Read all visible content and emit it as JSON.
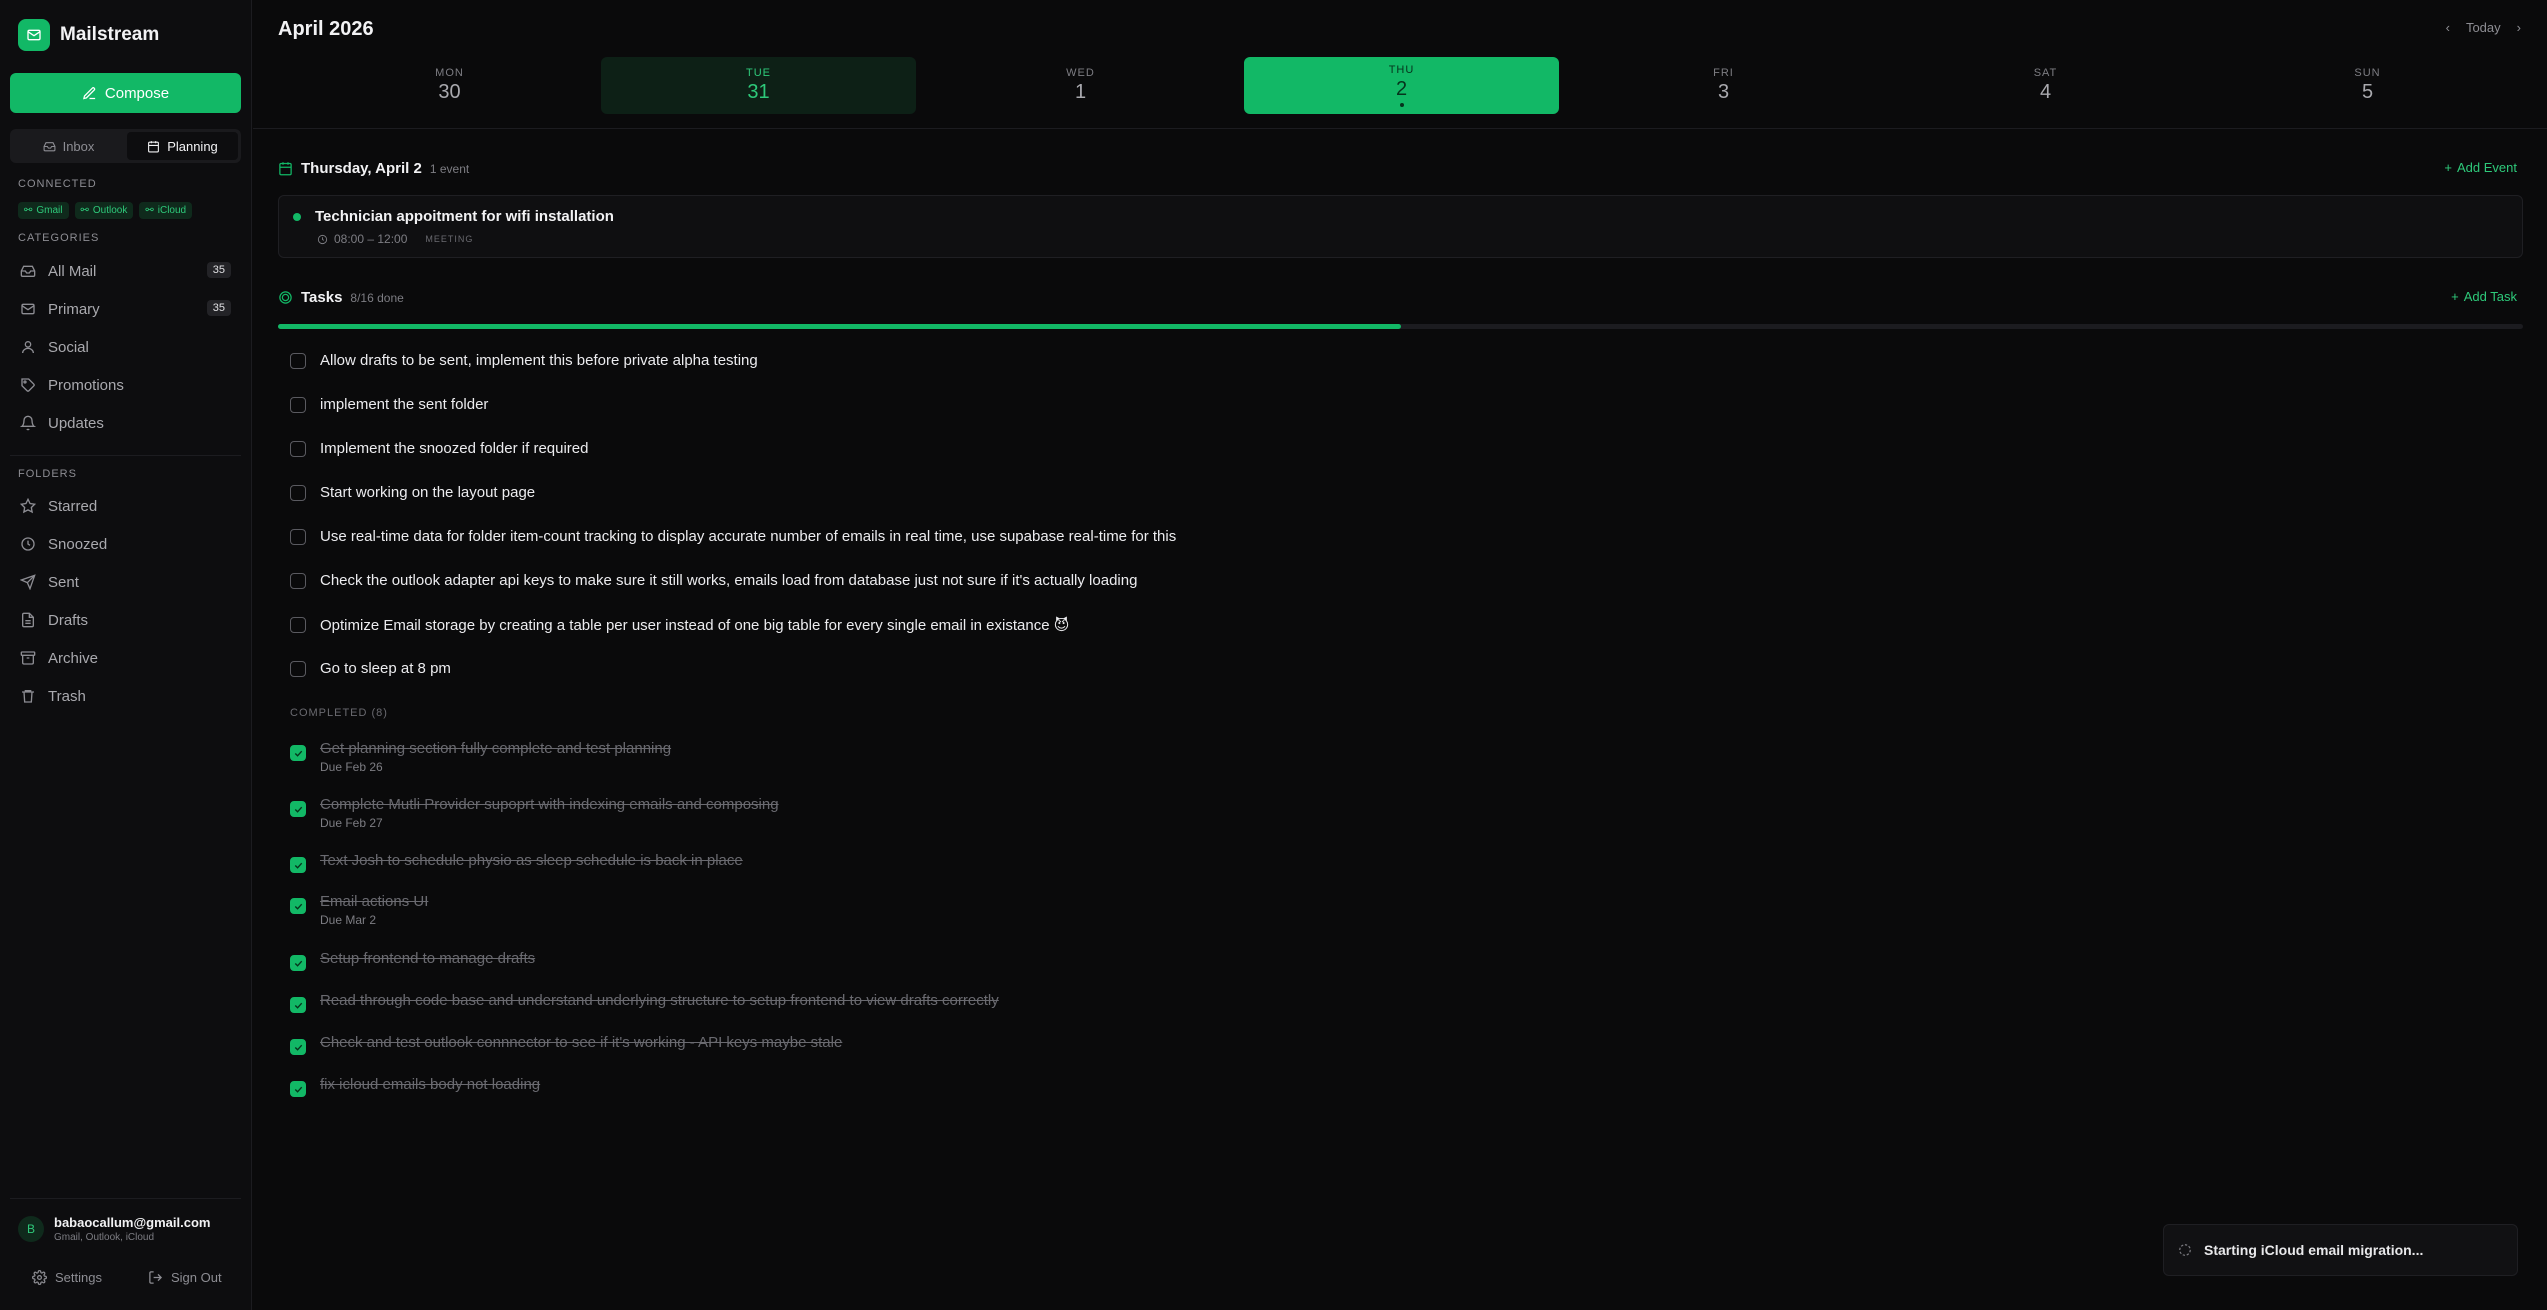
{
  "app": {
    "name": "Mailstream"
  },
  "sidebar": {
    "compose_label": "Compose",
    "switch": {
      "inbox": "Inbox",
      "planning": "Planning"
    },
    "connected_label": "CONNECTED",
    "connected": [
      "Gmail",
      "Outlook",
      "iCloud"
    ],
    "categories_label": "CATEGORIES",
    "categories": [
      {
        "label": "All Mail",
        "count": "35",
        "icon": "inbox-icon"
      },
      {
        "label": "Primary",
        "count": "35",
        "icon": "mail-icon"
      },
      {
        "label": "Social",
        "icon": "user-icon"
      },
      {
        "label": "Promotions",
        "icon": "tag-icon"
      },
      {
        "label": "Updates",
        "icon": "bell-icon"
      }
    ],
    "folders_label": "FOLDERS",
    "folders": [
      {
        "label": "Starred",
        "icon": "star-icon"
      },
      {
        "label": "Snoozed",
        "icon": "clock-icon"
      },
      {
        "label": "Sent",
        "icon": "send-icon"
      },
      {
        "label": "Drafts",
        "icon": "file-icon"
      },
      {
        "label": "Archive",
        "icon": "archive-icon"
      },
      {
        "label": "Trash",
        "icon": "trash-icon"
      }
    ],
    "user": {
      "initial": "B",
      "email": "babaocallum@gmail.com",
      "providers": "Gmail, Outlook, iCloud"
    },
    "settings_label": "Settings",
    "signout_label": "Sign Out"
  },
  "calendar": {
    "month_title": "April 2026",
    "today_label": "Today",
    "days": [
      {
        "name": "MON",
        "num": "30",
        "state": "normal"
      },
      {
        "name": "TUE",
        "num": "31",
        "state": "today"
      },
      {
        "name": "WED",
        "num": "1",
        "state": "normal"
      },
      {
        "name": "THU",
        "num": "2",
        "state": "selected"
      },
      {
        "name": "FRI",
        "num": "3",
        "state": "normal"
      },
      {
        "name": "SAT",
        "num": "4",
        "state": "normal"
      },
      {
        "name": "SUN",
        "num": "5",
        "state": "normal"
      }
    ]
  },
  "events": {
    "date_title": "Thursday, April 2",
    "count_label": "1 event",
    "add_label": "Add Event",
    "items": [
      {
        "title": "Technician appoitment for wifi installation",
        "time": "08:00 – 12:00",
        "type": "MEETING"
      }
    ]
  },
  "tasks": {
    "title": "Tasks",
    "done_label": "8/16 done",
    "progress": 0.5,
    "add_label": "Add Task",
    "open": [
      "Allow drafts to be sent, implement this before private alpha testing",
      "implement the sent folder",
      "Implement the snoozed folder if required",
      "Start working on the layout page",
      "Use real-time data for folder item-count tracking to display accurate number of emails in real time, use supabase real-time for this",
      "Check the outlook adapter api keys to make sure it still works, emails load from database just not sure if it's actually loading",
      "Optimize Email storage by creating a table per user instead of one big table for every single email in existance 😈",
      "Go to sleep at 8 pm"
    ],
    "completed_label": "COMPLETED (8)",
    "completed": [
      {
        "text": "Get planning section fully complete and test planning",
        "due": "Due Feb 26"
      },
      {
        "text": "Complete Mutli Provider supoprt with indexing emails and composing",
        "due": "Due Feb 27"
      },
      {
        "text": "Text Josh to schedule physio as sleep schedule is back in place",
        "due": ""
      },
      {
        "text": "Email actions UI",
        "due": "Due Mar 2"
      },
      {
        "text": "Setup frontend to manage drafts",
        "due": ""
      },
      {
        "text": "Read through code base and understand underlying structure to setup frontend to view drafts correctly",
        "due": ""
      },
      {
        "text": "Check and test outlook connnector to see if it's working - API keys maybe stale",
        "due": ""
      },
      {
        "text": "fix icloud emails body not loading",
        "due": ""
      }
    ]
  },
  "toast": {
    "message": "Starting iCloud email migration..."
  },
  "colors": {
    "accent": "#12b866",
    "background": "#0a0a0b",
    "sidebar": "#0d0d0f"
  }
}
